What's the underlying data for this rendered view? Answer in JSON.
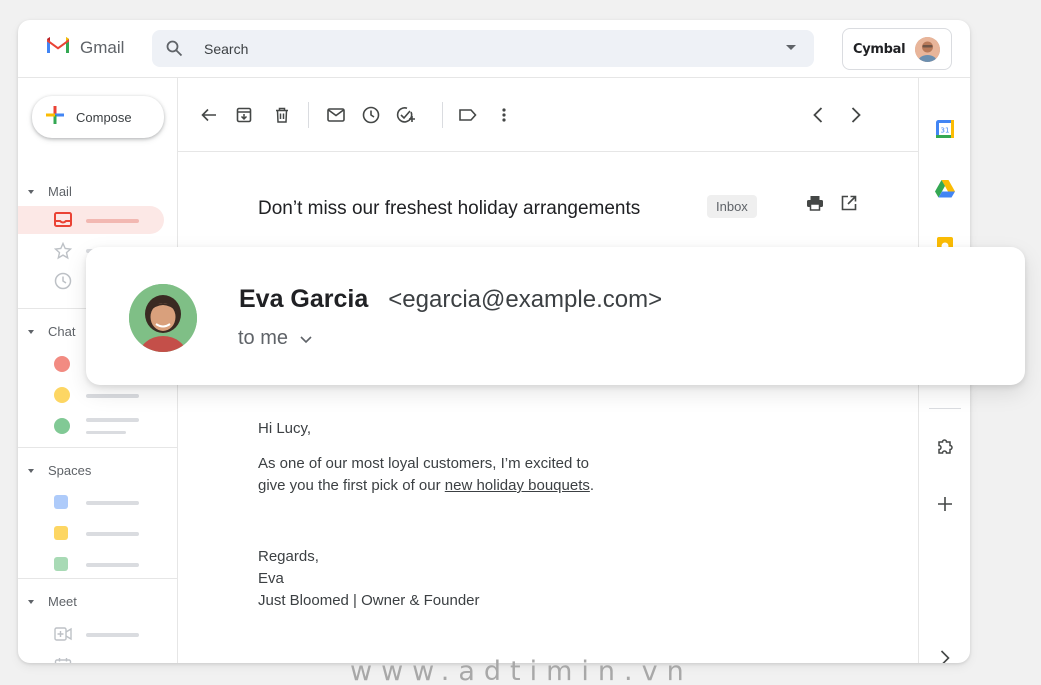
{
  "app": {
    "name": "Gmail",
    "brand": "Cymbal"
  },
  "search": {
    "placeholder": "Search"
  },
  "compose": {
    "label": "Compose"
  },
  "nav": {
    "mail": "Mail",
    "chat": "Chat",
    "spaces": "Spaces",
    "meet": "Meet"
  },
  "message": {
    "subject": "Don’t miss our freshest holiday arrangements",
    "label": "Inbox",
    "greeting": "Hi Lucy,",
    "paragraph_line1": "As one of our most loyal customers, I’m excited to",
    "paragraph_line2_prefix": "give you the first pick of our ",
    "link_text": "new holiday bouquets",
    "paragraph_line2_suffix": ".",
    "closing": "Regards,",
    "signature_name": "Eva",
    "signature_title": "Just Bloomed | Owner & Founder"
  },
  "sender": {
    "name": "Eva Garcia",
    "email": "<egarcia@example.com>",
    "recipient": "to me"
  },
  "watermark": "www.adtimin.vn",
  "colors": {
    "gmail_red": "#EA4335",
    "gmail_blue": "#4285F4",
    "gmail_yellow": "#FBBC04",
    "gmail_green": "#34A853",
    "active_nav": "#fce8e6"
  }
}
